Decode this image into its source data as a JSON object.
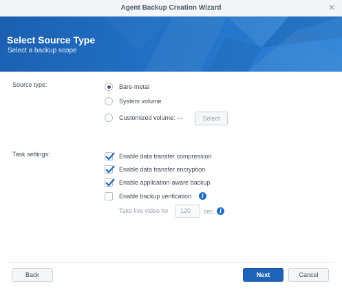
{
  "window": {
    "title": "Agent Backup Creation Wizard",
    "close_icon": "close-icon"
  },
  "header": {
    "title": "Select Source Type",
    "subtitle": "Select a backup scope"
  },
  "source_type": {
    "label": "Source type:",
    "options": [
      {
        "label": "Bare-metal",
        "selected": true
      },
      {
        "label": "System volume",
        "selected": false
      },
      {
        "label": "Customized volume: ---",
        "selected": false
      }
    ],
    "select_button": "Select"
  },
  "task_settings": {
    "label": "Task settings:",
    "options": [
      {
        "label": "Enable data transfer compression",
        "checked": true
      },
      {
        "label": "Enable data transfer encryption",
        "checked": true
      },
      {
        "label": "Enable application-aware backup",
        "checked": true
      },
      {
        "label": "Enable backup verification",
        "checked": false
      }
    ],
    "live_video": {
      "prefix": "Take live video for",
      "value": "120",
      "suffix": "sec."
    }
  },
  "footer": {
    "back": "Back",
    "next": "Next",
    "cancel": "Cancel"
  },
  "colors": {
    "accent": "#1e63b8",
    "header": "#2170c4"
  }
}
